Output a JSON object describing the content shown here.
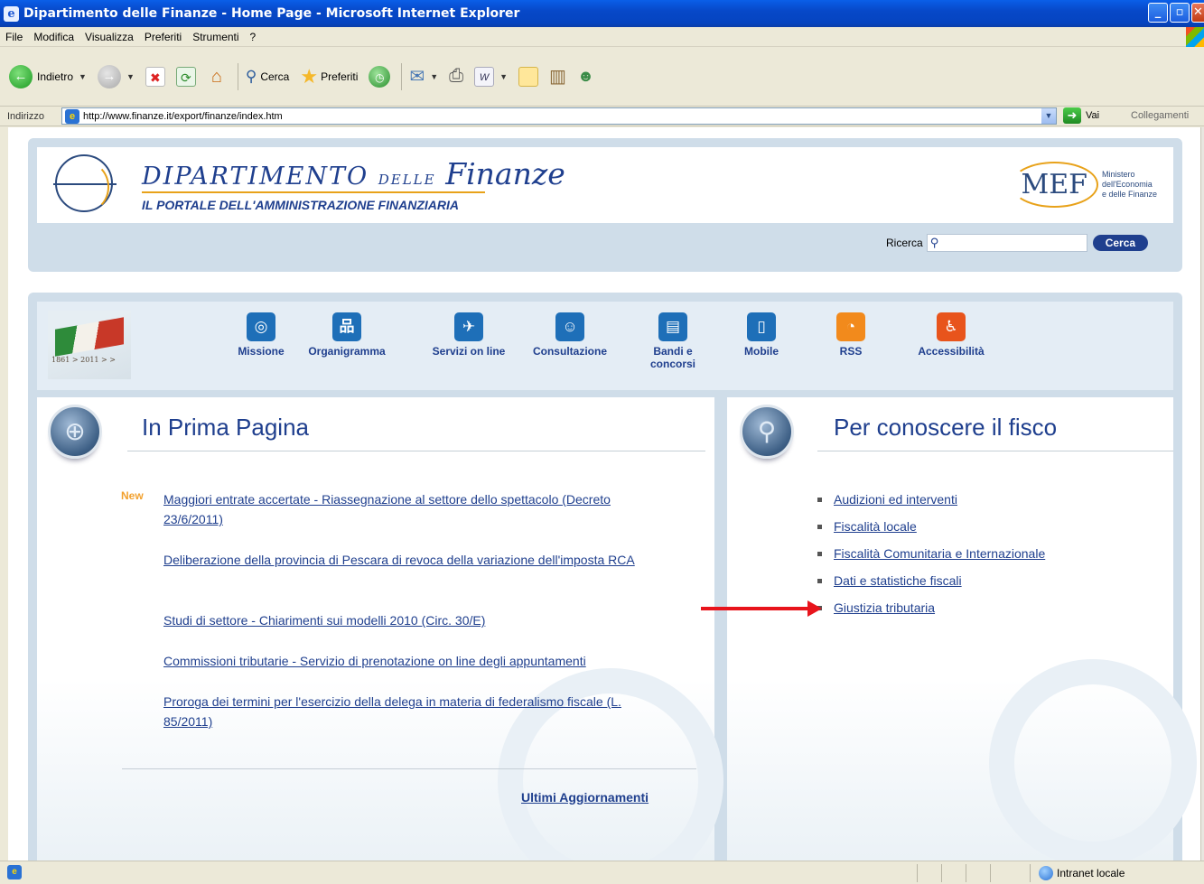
{
  "window": {
    "title": "Dipartimento delle Finanze - Home Page - Microsoft Internet Explorer",
    "icon": "ie-icon"
  },
  "menu": [
    "File",
    "Modifica",
    "Visualizza",
    "Preferiti",
    "Strumenti",
    "?"
  ],
  "toolbar": {
    "back_label": "Indietro",
    "search_label": "Cerca",
    "favorites_label": "Preferiti"
  },
  "address": {
    "label": "Indirizzo",
    "url": "http://www.finanze.it/export/finanze/index.htm",
    "go_label": "Vai",
    "links_label": "Collegamenti"
  },
  "header": {
    "title_main": "DIPARTIMENTO",
    "title_delle": "DELLE",
    "title_finanze": "Finanze",
    "subtitle": "IL PORTALE DELL'AMMINISTRAZIONE FINANZIARIA",
    "mef_mark": "MEF",
    "mef_line1": "Ministero",
    "mef_line2": "dell'Economia",
    "mef_line3": "e delle Finanze",
    "search_label": "Ricerca",
    "search_button": "Cerca"
  },
  "unita": {
    "text": "1861 > 2011 > >"
  },
  "nav": [
    {
      "label": "Missione",
      "icon": "target-icon",
      "color": "#1e6fb8"
    },
    {
      "label": "Organigramma",
      "icon": "org-chart-icon",
      "color": "#1e6fb8"
    },
    {
      "label": "Servizi on line",
      "icon": "bird-icon",
      "color": "#1e6fb8"
    },
    {
      "label": "Consultazione",
      "icon": "people-chat-icon",
      "color": "#1e6fb8"
    },
    {
      "label": "Bandi e concorsi",
      "icon": "document-icon",
      "color": "#1e6fb8"
    },
    {
      "label": "Mobile",
      "icon": "mobile-icon",
      "color": "#1e6fb8"
    },
    {
      "label": "RSS",
      "icon": "rss-icon",
      "color": "#f28a1c"
    },
    {
      "label": "Accessibilità",
      "icon": "accessibility-icon",
      "color": "#e8541c"
    }
  ],
  "prima_pagina": {
    "title": "In Prima Pagina",
    "new_badge": "New",
    "news": [
      "Maggiori entrate accertate - Riassegnazione al settore dello spettacolo (Decreto 23/6/2011)",
      "Deliberazione della provincia di Pescara di revoca della variazione dell'imposta RCA",
      "Studi di settore - Chiarimenti sui modelli 2010 (Circ. 30/E)",
      "Commissioni tributarie - Servizio di prenotazione on line degli appuntamenti",
      "Proroga dei termini per l'esercizio della delega in materia di federalismo fiscale (L. 85/2011)"
    ],
    "more_link": "Ultimi Aggiornamenti"
  },
  "fisco": {
    "title": "Per conoscere il fisco",
    "items": [
      "Audizioni ed interventi",
      "Fiscalità locale",
      "Fiscalità Comunitaria e Internazionale",
      "Dati e statistiche fiscali",
      "Giustizia tributaria"
    ]
  },
  "status": {
    "zone": "Intranet locale"
  },
  "colors": {
    "brand_blue": "#1f3f8e",
    "accent_orange": "#e8a21a",
    "annotation_red": "#e8141c"
  }
}
